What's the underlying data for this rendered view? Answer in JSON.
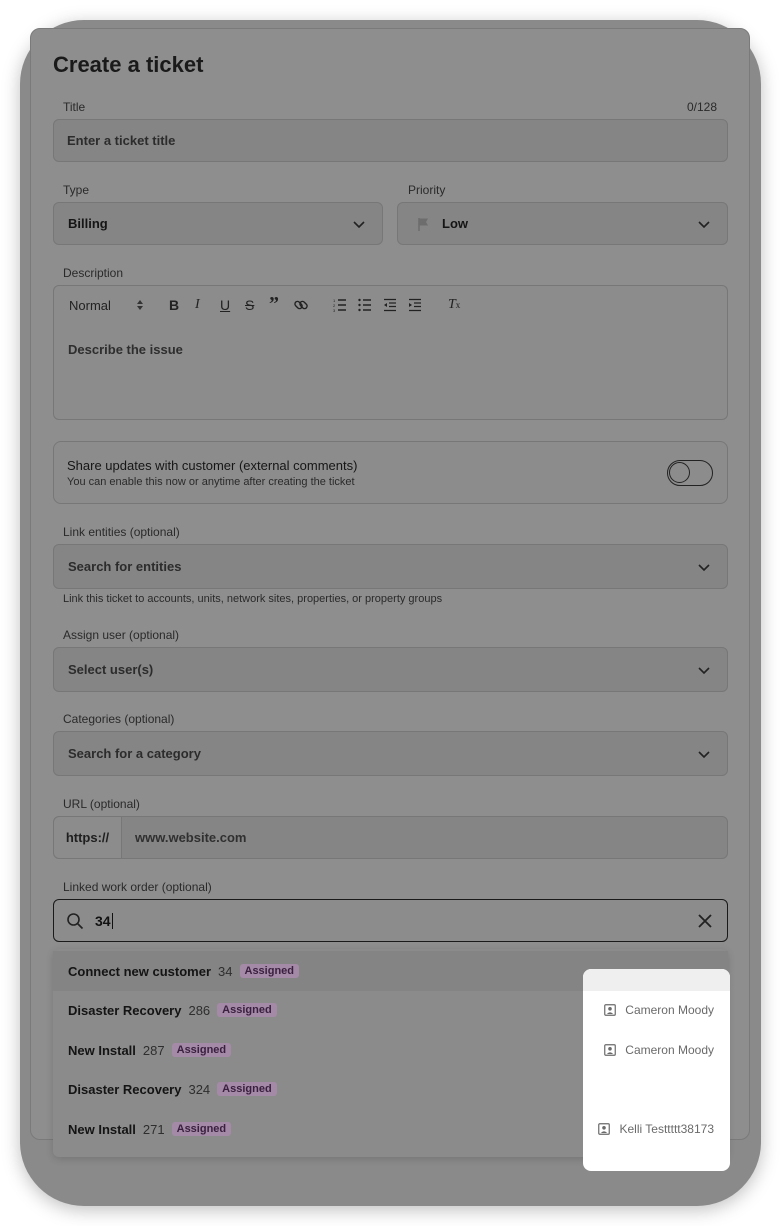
{
  "modal": {
    "title": "Create a ticket",
    "title_field": {
      "label": "Title",
      "counter": "0/128",
      "placeholder": "Enter a ticket title"
    },
    "type_field": {
      "label": "Type",
      "value": "Billing"
    },
    "priority_field": {
      "label": "Priority",
      "value": "Low"
    },
    "description": {
      "label": "Description",
      "style_select": "Normal",
      "placeholder": "Describe the issue",
      "toolbar_icons": [
        "bold-icon",
        "italic-icon",
        "underline-icon",
        "strikethrough-icon",
        "quote-icon",
        "link-icon",
        "ordered-list-icon",
        "bullet-list-icon",
        "outdent-icon",
        "indent-icon",
        "clear-format-icon"
      ]
    },
    "share": {
      "title": "Share updates with customer (external comments)",
      "subtitle": "You can enable this now or anytime after creating the ticket",
      "enabled": false
    },
    "link_entities": {
      "label": "Link entities (optional)",
      "placeholder": "Search for entities",
      "hint": "Link this ticket to accounts, units, network sites, properties, or property groups"
    },
    "assign_user": {
      "label": "Assign user (optional)",
      "placeholder": "Select user(s)"
    },
    "categories": {
      "label": "Categories (optional)",
      "placeholder": "Search for a category"
    },
    "url": {
      "label": "URL (optional)",
      "prefix": "https://",
      "placeholder": "www.website.com"
    },
    "work_order": {
      "label": "Linked work order (optional)",
      "query": "34",
      "results": [
        {
          "name": "Connect new customer",
          "number": "34",
          "status": "Assigned",
          "assignee": ""
        },
        {
          "name": "Disaster Recovery",
          "number": "286",
          "status": "Assigned",
          "assignee": "Cameron Moody"
        },
        {
          "name": "New Install",
          "number": "287",
          "status": "Assigned",
          "assignee": "Cameron Moody"
        },
        {
          "name": "Disaster Recovery",
          "number": "324",
          "status": "Assigned",
          "assignee": ""
        },
        {
          "name": "New Install",
          "number": "271",
          "status": "Assigned",
          "assignee": "Kelli Testtttt38173"
        }
      ]
    }
  },
  "colors": {
    "overlay": "#8a8a8a",
    "badge_bg": "#a48aa6",
    "badge_text": "#3b1f40"
  }
}
